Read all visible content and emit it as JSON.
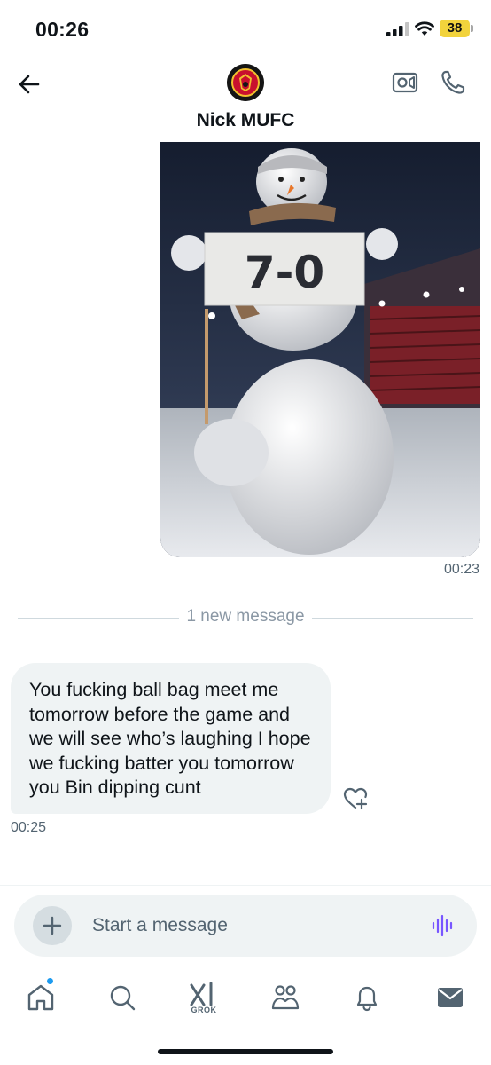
{
  "status_bar": {
    "time": "00:26",
    "battery": "38"
  },
  "header": {
    "contact_name": "Nick MUFC",
    "back_icon": "arrow-left-icon",
    "video_icon": "video-call-icon",
    "call_icon": "phone-icon"
  },
  "messages": {
    "image_message": {
      "sign_text": "7-0",
      "timestamp": "00:23"
    },
    "new_message_divider": "1 new message",
    "text_message": {
      "text": "You fucking ball bag meet me tomorrow before the game and we will see who’s laughing I hope we fucking batter you tomorrow you Bin dipping cunt",
      "timestamp": "00:25",
      "react_icon": "heart-plus-icon"
    }
  },
  "composer": {
    "placeholder": "Start a message",
    "add_icon": "plus-icon",
    "voice_icon": "voice-waveform-icon"
  },
  "nav": {
    "items": [
      "home-icon",
      "search-icon",
      "grok-icon",
      "communities-icon",
      "notifications-icon",
      "messages-icon"
    ],
    "grok_label": "GROK"
  },
  "colors": {
    "accent": "#1d9bf0",
    "voice": "#7856ff",
    "bubble": "#eff3f4",
    "battery": "#f2d33c"
  }
}
